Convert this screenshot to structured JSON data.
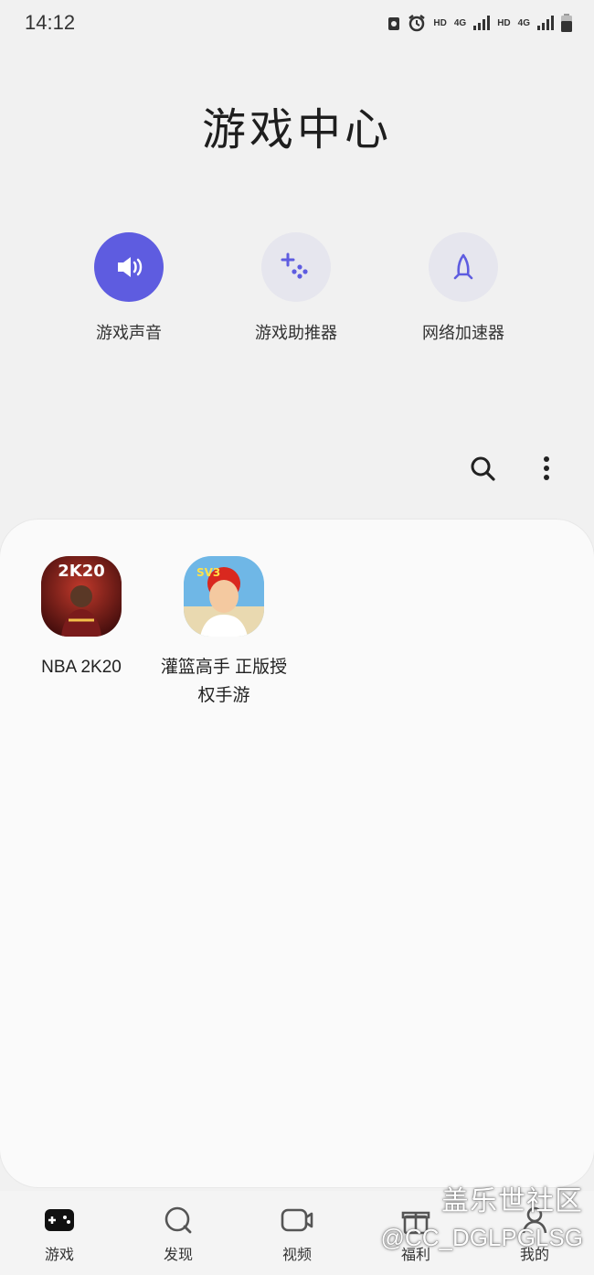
{
  "status": {
    "time": "14:12",
    "indicators": [
      "HD",
      "4G",
      "HD",
      "4G"
    ]
  },
  "page": {
    "title": "游戏中心"
  },
  "quick_actions": [
    {
      "label": "游戏声音",
      "icon": "speaker-icon",
      "active": true
    },
    {
      "label": "游戏助推器",
      "icon": "game-booster-icon",
      "active": false
    },
    {
      "label": "网络加速器",
      "icon": "rocket-icon",
      "active": false
    }
  ],
  "toolbar": {
    "search_icon": "search-icon",
    "more_icon": "more-vert-icon"
  },
  "games": [
    {
      "name": "NBA 2K20",
      "icon_text": "2K20"
    },
    {
      "name": "灌篮高手 正版授权手游",
      "icon_text": "SV3"
    }
  ],
  "bottom_nav": [
    {
      "label": "游戏",
      "icon": "gamepad-icon",
      "active": true
    },
    {
      "label": "发现",
      "icon": "discover-icon",
      "active": false
    },
    {
      "label": "视频",
      "icon": "video-icon",
      "active": false
    },
    {
      "label": "福利",
      "icon": "gift-icon",
      "active": false
    },
    {
      "label": "我的",
      "icon": "profile-icon",
      "active": false
    }
  ],
  "watermark": {
    "line1": "盖乐世社区",
    "line2": "@CC_DGLPGLSG"
  },
  "colors": {
    "accent": "#5e5ce0",
    "background": "#f1f1f1",
    "panel": "#fafafa"
  }
}
